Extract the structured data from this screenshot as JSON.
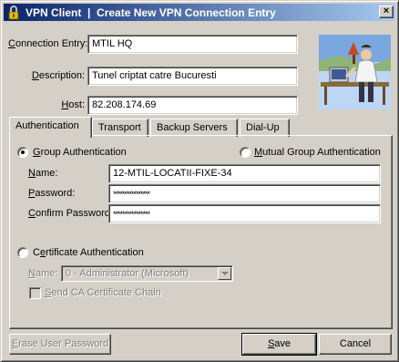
{
  "window": {
    "title": "VPN Client  |  Create New VPN Connection Entry",
    "close_glyph": "×"
  },
  "fields": {
    "connection_entry": {
      "label_prefix": "",
      "label_accel": "C",
      "label_rest": "onnection Entry:",
      "value": "MTIL HQ"
    },
    "description": {
      "label_prefix": "",
      "label_accel": "D",
      "label_rest": "escription:",
      "value": "Tunel criptat catre Bucuresti"
    },
    "host": {
      "label_prefix": "",
      "label_accel": "H",
      "label_rest": "ost:",
      "value": "82.208.174.69"
    }
  },
  "tabs": [
    {
      "label": "Authentication",
      "active": true
    },
    {
      "label": "Transport",
      "active": false
    },
    {
      "label": "Backup Servers",
      "active": false
    },
    {
      "label": "Dial-Up",
      "active": false
    }
  ],
  "auth": {
    "group_auth": {
      "accel": "G",
      "rest": "roup Authentication",
      "selected": true
    },
    "mutual_group_auth": {
      "accel": "M",
      "rest": "utual Group Authentication",
      "selected": false
    },
    "name": {
      "accel": "N",
      "rest": "ame:",
      "value": "12-MTIL-LOCATII-FIXE-34"
    },
    "password": {
      "accel": "P",
      "rest": "assword:",
      "value": "****************"
    },
    "confirm_password": {
      "prefix": "",
      "accel": "C",
      "rest": "onfirm Password:",
      "value": "****************"
    },
    "certificate_auth": {
      "prefix": "C",
      "accel": "e",
      "rest": "rtificate Authentication",
      "selected": false
    },
    "cert_name": {
      "accel": "N",
      "rest": "ame:",
      "value": "0 - Administrator (Microsoft)"
    },
    "send_ca_chain": {
      "prefix": "",
      "accel": "S",
      "rest": "end CA Certificate Chain",
      "checked": false
    }
  },
  "buttons": {
    "erase_user_password": {
      "prefix": "",
      "accel": "E",
      "rest": "rase User Password"
    },
    "save": {
      "prefix": "",
      "accel": "S",
      "rest": "ave"
    },
    "cancel": {
      "label": "Cancel"
    }
  },
  "icons": {
    "app": "vpn-lock-icon",
    "logo": "vpn-client-illustration"
  },
  "colors": {
    "titlebar_start": "#0a246a",
    "titlebar_end": "#a6caf0",
    "face": "#d4d0c8",
    "disabled_text": "#808080"
  }
}
